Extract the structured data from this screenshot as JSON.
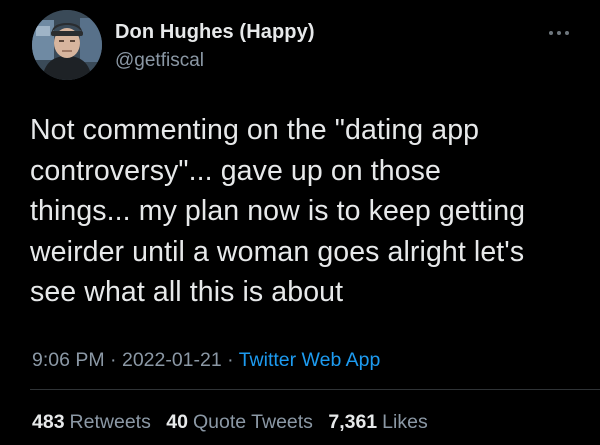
{
  "author": {
    "display_name": "Don Hughes (Happy)",
    "handle": "@getfiscal",
    "avatar_icon": "user-avatar"
  },
  "tweet": {
    "text": "Not commenting on the \"dating app\ncontroversy\"... gave up on those\nthings... my plan now is to keep getting\nweirder until a woman goes alright let's\nsee what all this is about",
    "time": "9:06 PM",
    "date": "2022-01-21",
    "separator": "·",
    "source": "Twitter Web App"
  },
  "stats": [
    {
      "count": "483",
      "label": "Retweets"
    },
    {
      "count": "40",
      "label": "Quote Tweets"
    },
    {
      "count": "7,361",
      "label": "Likes"
    }
  ],
  "colors": {
    "background": "#000000",
    "text": "#e7e9ea",
    "secondary": "#8b98a5",
    "link": "#1d9bf0",
    "divider": "#2f3336"
  },
  "more_icon": "more-dots-icon"
}
